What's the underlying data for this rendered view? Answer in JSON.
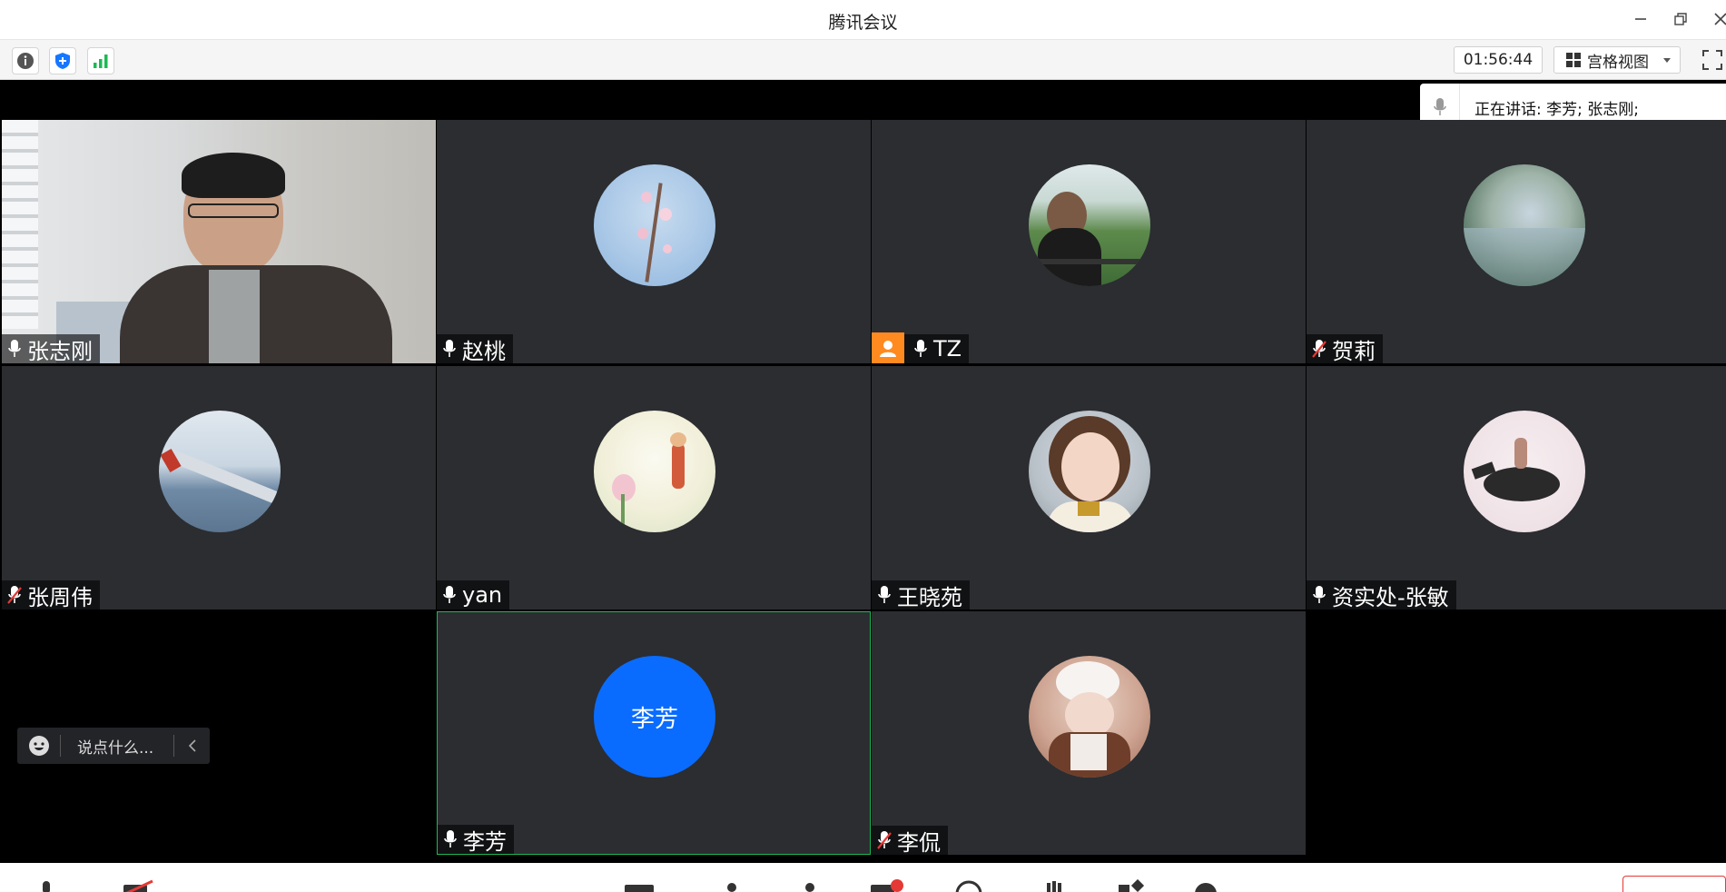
{
  "window": {
    "title": "腾讯会议"
  },
  "toolbar": {
    "info_icon": "info-icon",
    "security_icon": "shield-icon",
    "network_icon": "signal-bars-icon",
    "timer": "01:56:44",
    "view_label": "宫格视图",
    "accent_green": "#1db954",
    "accent_blue": "#1677ff"
  },
  "speaking": {
    "text": "正在讲话: 李芳; 张志刚;"
  },
  "participants": [
    {
      "name": "张志刚",
      "mic": "on",
      "video": true
    },
    {
      "name": "赵桃",
      "mic": "on"
    },
    {
      "name": "TZ",
      "mic": "on",
      "host": true
    },
    {
      "name": "贺莉",
      "mic": "muted"
    },
    {
      "name": "张周伟",
      "mic": "muted"
    },
    {
      "name": "yan",
      "mic": "on"
    },
    {
      "name": "王晓苑",
      "mic": "on"
    },
    {
      "name": "资实处-张敏",
      "mic": "on"
    },
    {
      "name": "李芳",
      "mic": "on",
      "initials": "李芳",
      "avatar_color": "#0a6cff",
      "active_speaker": true
    },
    {
      "name": "李侃",
      "mic": "muted"
    }
  ],
  "chat": {
    "placeholder": "说点什么..."
  },
  "colors": {
    "tile_bg": "#2b2d31",
    "host_badge": "#ff8a1f",
    "muted_red": "#e53935"
  }
}
